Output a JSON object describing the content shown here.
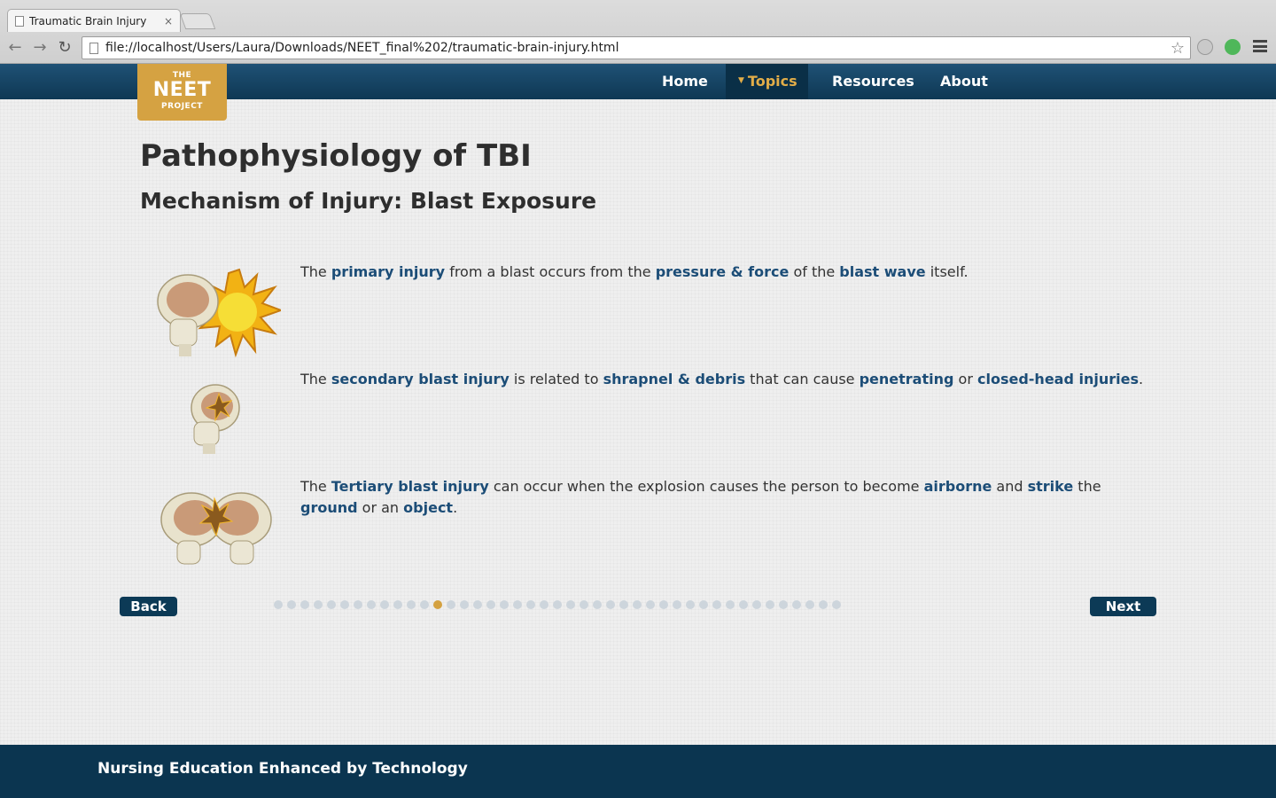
{
  "browser": {
    "tab_title": "Traumatic Brain Injury",
    "tab_close": "×",
    "back_glyph": "←",
    "forward_glyph": "→",
    "reload_glyph": "↻",
    "url": "file://localhost/Users/Laura/Downloads/NEET_final%202/traumatic-brain-injury.html",
    "star_glyph": "☆"
  },
  "logo": {
    "line1": "THE",
    "line2": "NEET",
    "line3": "PROJECT"
  },
  "nav": {
    "home": "Home",
    "topics": "Topics",
    "topics_caret": "▼",
    "resources": "Resources",
    "about": "About"
  },
  "page": {
    "title": "Pathophysiology of TBI",
    "subtitle": "Mechanism of Injury: Blast Exposure"
  },
  "rows": {
    "primary": {
      "t1": "The ",
      "k1": "primary injury",
      "t2": " from a blast occurs from the ",
      "k2": "pressure & force",
      "t3": " of the ",
      "k3": "blast wave",
      "t4": " itself."
    },
    "secondary": {
      "t1": "The ",
      "k1": "secondary blast injury",
      "t2": " is related to ",
      "k2": "shrapnel & debris",
      "t3": " that can cause ",
      "k3": "penetrating",
      "t4": " or ",
      "k4": "closed-head injuries",
      "t5": "."
    },
    "tertiary": {
      "t1": "The ",
      "k1": "Tertiary blast injury",
      "t2": " can occur when the explosion causes the person to become ",
      "k2": "airborne",
      "t3": " and ",
      "k3": "strike",
      "t4": " the ",
      "k4": "ground",
      "t5": " or an ",
      "k5": "object",
      "t6": "."
    }
  },
  "pager": {
    "back": "Back",
    "next": "Next",
    "total": 43,
    "current": 12
  },
  "footer": {
    "text": "Nursing Education Enhanced by Technology"
  },
  "colors": {
    "accent": "#d5a242",
    "navy": "#0c3a56",
    "keyword": "#1c4d77"
  }
}
